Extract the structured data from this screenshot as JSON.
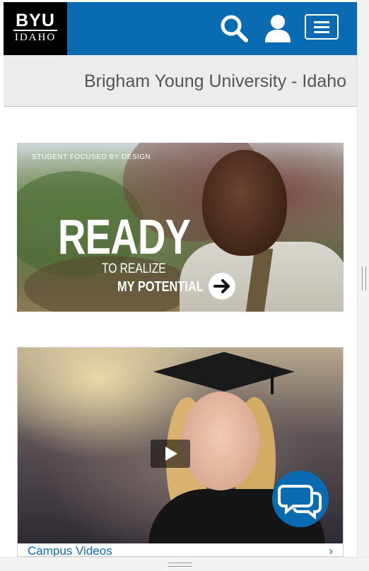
{
  "header": {
    "logo_top": "BYU",
    "logo_bottom": "IDAHO",
    "icons": [
      "search-icon",
      "user-icon",
      "hamburger-menu-icon"
    ],
    "colors": {
      "brand_blue": "#0a6bb3",
      "logo_bg": "#000000"
    }
  },
  "subheader": {
    "title": "Brigham Young University - Idaho"
  },
  "promo": {
    "tagline": "STUDENT FOCUSED BY DESIGN",
    "headline": "READY",
    "line2": "TO REALIZE",
    "line3": "MY POTENTIAL",
    "icon": "arrow-right-icon"
  },
  "video": {
    "link_label": "Campus Videos",
    "link_icon": "chevron-right-icon",
    "play_icon": "play-icon"
  },
  "chat": {
    "icon": "chat-bubbles-icon"
  }
}
